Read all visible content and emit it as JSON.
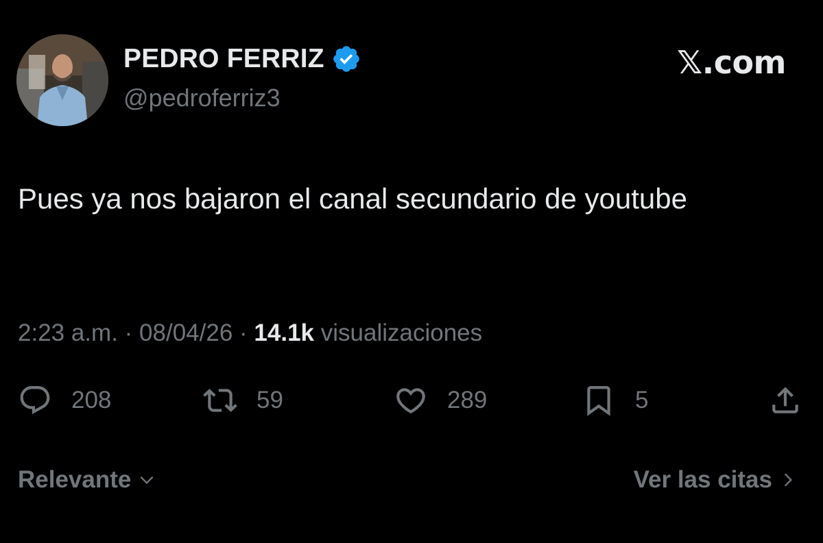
{
  "author": {
    "display_name": "PEDRO FERRIZ",
    "handle": "@pedroferriz3",
    "verified": true
  },
  "brand": "𝕏.com",
  "tweet": {
    "text": "Pues ya nos bajaron el canal secundario de youtube",
    "time": "2:23 a.m.",
    "date": "08/04/26",
    "views_count": "14.1k",
    "views_label": "visualizaciones"
  },
  "actions": {
    "replies": "208",
    "reposts": "59",
    "likes": "289",
    "bookmarks": "5"
  },
  "footer": {
    "sort_label": "Relevante",
    "quotes_label": "Ver las citas"
  },
  "colors": {
    "background": "#000000",
    "primary_text": "#e7e9ea",
    "secondary_text": "#71767b",
    "verified_badge": "#1d9bf0"
  }
}
